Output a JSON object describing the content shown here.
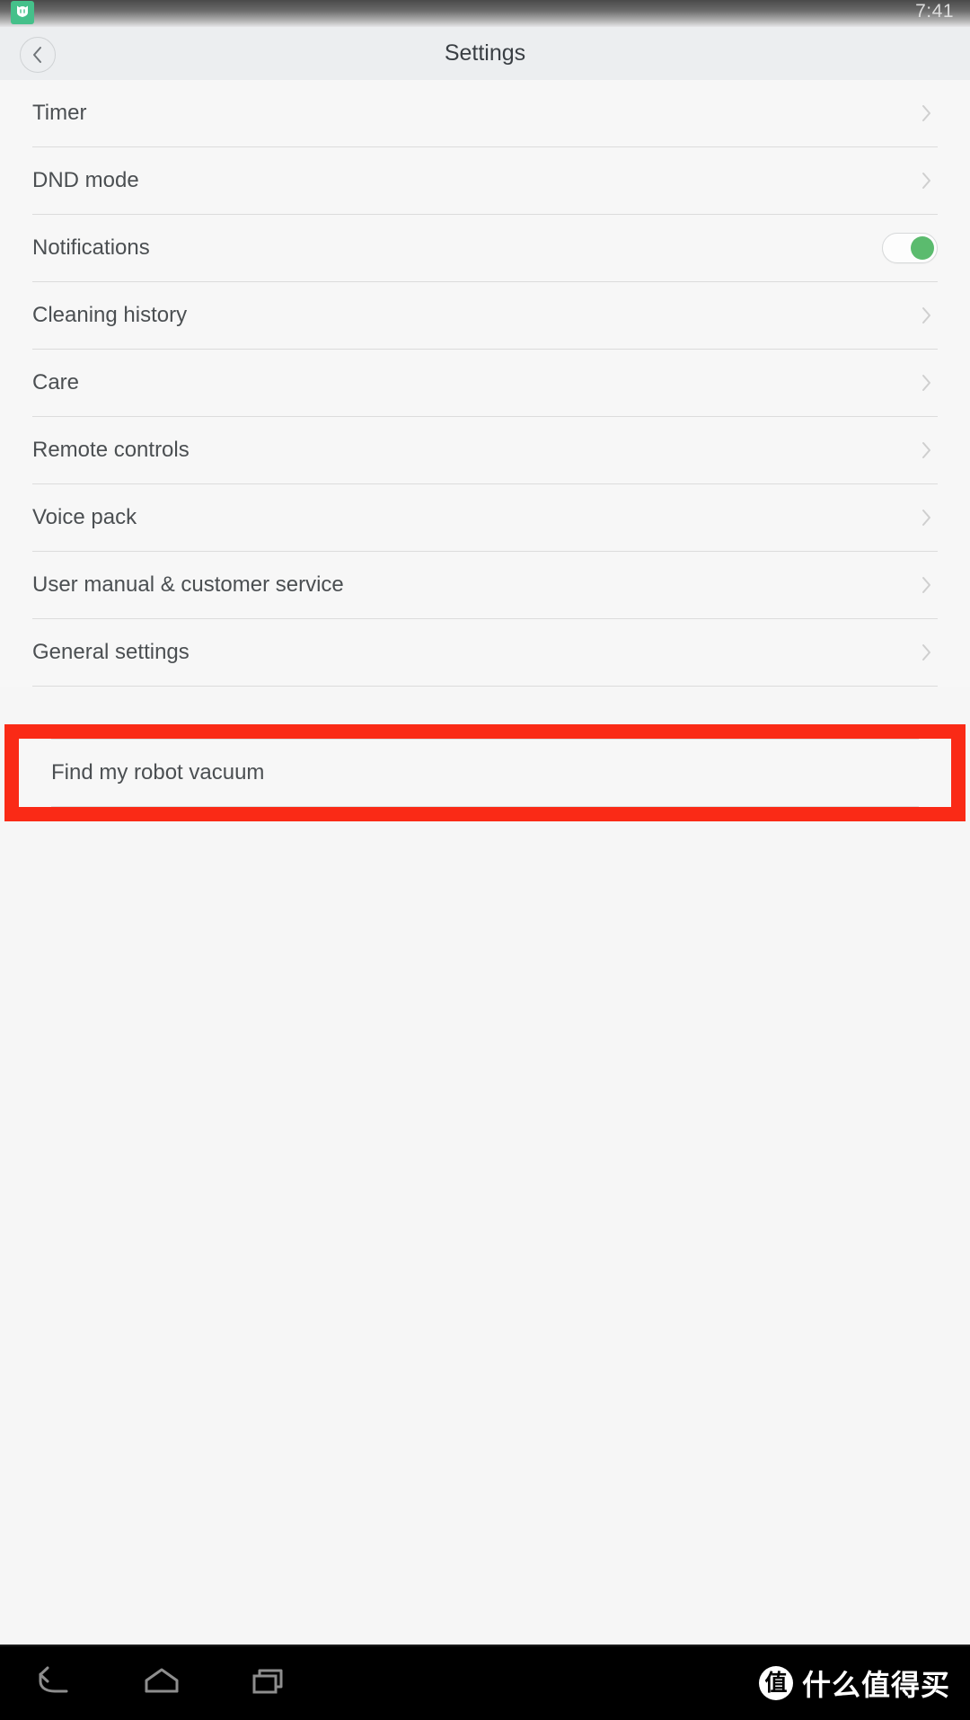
{
  "status_bar": {
    "app_icon": "mi-home-app-icon",
    "app_glyph": "♥",
    "time": "7:41",
    "accent": "#45c08a"
  },
  "header": {
    "title": "Settings",
    "back_icon": "chevron-left-icon"
  },
  "settings_groups": [
    {
      "items": [
        {
          "label": "Timer",
          "accessory": "chevron"
        },
        {
          "label": "DND mode",
          "accessory": "chevron"
        },
        {
          "label": "Notifications",
          "accessory": "toggle",
          "toggle_on": true
        },
        {
          "label": "Cleaning history",
          "accessory": "chevron"
        },
        {
          "label": "Care",
          "accessory": "chevron"
        },
        {
          "label": "Remote controls",
          "accessory": "chevron"
        },
        {
          "label": "Voice pack",
          "accessory": "chevron"
        },
        {
          "label": "User manual & customer service",
          "accessory": "chevron"
        },
        {
          "label": "General settings",
          "accessory": "chevron"
        }
      ]
    },
    {
      "highlighted": true,
      "items": [
        {
          "label": "Find my robot vacuum",
          "accessory": "none"
        }
      ]
    }
  ],
  "highlight": {
    "color": "#fa2a16",
    "target_label": "Find my robot vacuum"
  },
  "nav_bar": {
    "buttons": [
      {
        "name": "back-nav-button",
        "icon": "back-arrow-icon"
      },
      {
        "name": "home-nav-button",
        "icon": "home-icon"
      },
      {
        "name": "recents-nav-button",
        "icon": "recents-icon"
      }
    ],
    "watermark_badge": "值",
    "watermark_text": "什么值得买"
  },
  "toggle_colors": {
    "knob_on": "#5bbb6e",
    "track": "#fdfdfd"
  }
}
